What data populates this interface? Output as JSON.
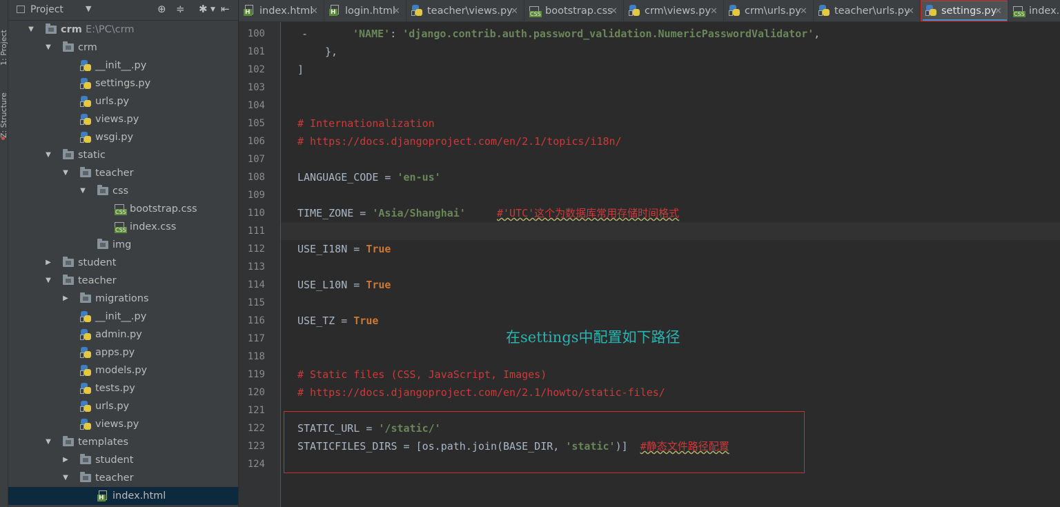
{
  "toolwindow": {
    "project_label": "1: Project",
    "structure_label": "Z: Structure"
  },
  "project_panel": {
    "title": "Project"
  },
  "tree": [
    {
      "label": "crm",
      "path": "E:\\PC\\crm",
      "kind": "folder",
      "depth": 0,
      "expanded": true
    },
    {
      "label": "crm",
      "kind": "folder",
      "depth": 1,
      "expanded": true
    },
    {
      "label": "__init__.py",
      "kind": "py",
      "depth": 2
    },
    {
      "label": "settings.py",
      "kind": "py",
      "depth": 2
    },
    {
      "label": "urls.py",
      "kind": "py",
      "depth": 2
    },
    {
      "label": "views.py",
      "kind": "py",
      "depth": 2
    },
    {
      "label": "wsgi.py",
      "kind": "py",
      "depth": 2
    },
    {
      "label": "static",
      "kind": "folder",
      "depth": 1,
      "expanded": true
    },
    {
      "label": "teacher",
      "kind": "folder",
      "depth": 2,
      "expanded": true
    },
    {
      "label": "css",
      "kind": "folder",
      "depth": 3,
      "expanded": true
    },
    {
      "label": "bootstrap.css",
      "kind": "css",
      "depth": 4
    },
    {
      "label": "index.css",
      "kind": "css",
      "depth": 4
    },
    {
      "label": "img",
      "kind": "folder",
      "depth": 3
    },
    {
      "label": "student",
      "kind": "folder",
      "depth": 1,
      "expanded": false
    },
    {
      "label": "teacher",
      "kind": "folder",
      "depth": 1,
      "expanded": true
    },
    {
      "label": "migrations",
      "kind": "folder",
      "depth": 2,
      "expanded": false
    },
    {
      "label": "__init__.py",
      "kind": "py",
      "depth": 2
    },
    {
      "label": "admin.py",
      "kind": "py",
      "depth": 2
    },
    {
      "label": "apps.py",
      "kind": "py",
      "depth": 2
    },
    {
      "label": "models.py",
      "kind": "py",
      "depth": 2
    },
    {
      "label": "tests.py",
      "kind": "py",
      "depth": 2
    },
    {
      "label": "urls.py",
      "kind": "py",
      "depth": 2
    },
    {
      "label": "views.py",
      "kind": "py",
      "depth": 2
    },
    {
      "label": "templates",
      "kind": "folder",
      "depth": 1,
      "expanded": true
    },
    {
      "label": "student",
      "kind": "folder",
      "depth": 2,
      "expanded": false
    },
    {
      "label": "teacher",
      "kind": "folder",
      "depth": 2,
      "expanded": true
    },
    {
      "label": "index.html",
      "kind": "html",
      "depth": 3,
      "selected": true
    }
  ],
  "tabs": [
    {
      "label": "index.html",
      "kind": "html"
    },
    {
      "label": "login.html",
      "kind": "html"
    },
    {
      "label": "teacher\\views.py",
      "kind": "py"
    },
    {
      "label": "bootstrap.css",
      "kind": "css"
    },
    {
      "label": "crm\\views.py",
      "kind": "py"
    },
    {
      "label": "crm\\urls.py",
      "kind": "py"
    },
    {
      "label": "teacher\\urls.py",
      "kind": "py"
    },
    {
      "label": "settings.py",
      "kind": "py",
      "active": true
    },
    {
      "label": "index.c",
      "kind": "css"
    }
  ],
  "code": {
    "line_numbers": [
      "100",
      "101",
      "102",
      "103",
      "104",
      "105",
      "106",
      "107",
      "108",
      "109",
      "110",
      "111",
      "112",
      "113",
      "114",
      "115",
      "116",
      "117",
      "118",
      "119",
      "120",
      "121",
      "122",
      "123",
      "124"
    ],
    "l100_key": "'NAME'",
    "l100_val": "'django.contrib.auth.password_validation.NumericPasswordValidator'",
    "l101": "},",
    "l102": "]",
    "l105": "# Internationalization",
    "l106": "# https://docs.djangoproject.com/en/2.1/topics/i18n/",
    "l108_name": "LANGUAGE_CODE",
    "l108_val": "'en-us'",
    "l110_name": "TIME_ZONE",
    "l110_val": "'Asia/Shanghai'",
    "l110_comment": "#'UTC'这个为数据库常用存储时间格式",
    "l112_name": "USE_I18N",
    "l114_name": "USE_L10N",
    "l116_name": "USE_TZ",
    "true_kw": "True",
    "l119": "# Static files (CSS, JavaScript, Images)",
    "l120": "# https://docs.djangoproject.com/en/2.1/howto/static-files/",
    "l122_name": "STATIC_URL",
    "l122_val": "'/static/'",
    "l123_name": "STATICFILES_DIRS",
    "l123_call": "os.path.join(BASE_DIR, ",
    "l123_val": "'static'",
    "l123_comment": "#静态文件路径配置"
  },
  "annotation_text": "在settings中配置如下路径",
  "colors": {
    "keyword": "#cc7832",
    "string": "#6a8759",
    "comment": "#cc3a3a",
    "annotation": "#29b5b2",
    "highlight_box": "#c8312e"
  }
}
